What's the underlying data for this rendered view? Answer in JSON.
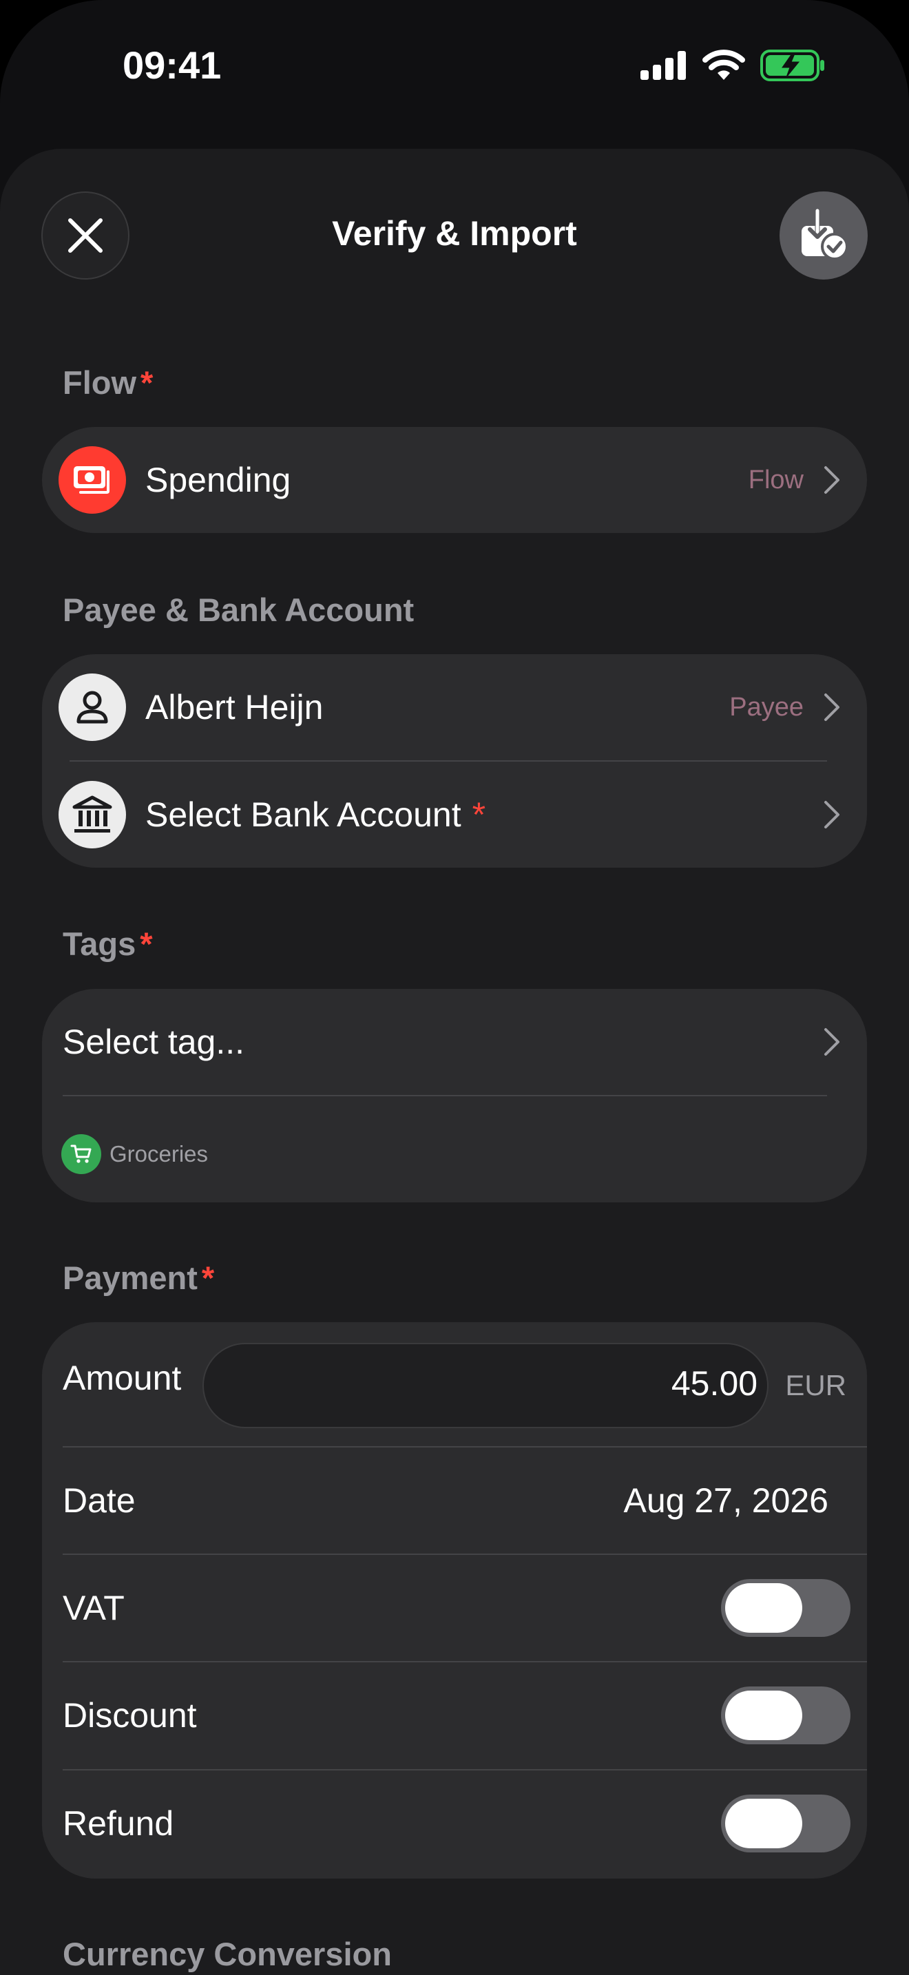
{
  "status_bar": {
    "time": "09:41"
  },
  "sheet": {
    "title": "Verify & Import",
    "close_icon": "close-icon",
    "import_icon": "import-confirm-icon"
  },
  "flow": {
    "label": "Flow",
    "required_mark": "*",
    "value": "Spending",
    "hint": "Flow",
    "icon": "money-icon",
    "icon_color": "#ff3b30"
  },
  "payee_bank": {
    "label": "Payee & Bank Account",
    "payee_value": "Albert Heijn",
    "payee_hint": "Payee",
    "payee_icon": "person-icon",
    "bank_value": "Select Bank Account",
    "bank_required_mark": "*",
    "bank_icon": "bank-icon"
  },
  "tags": {
    "label": "Tags",
    "required_mark": "*",
    "select_label": "Select tag...",
    "chips": [
      {
        "label": "Groceries",
        "icon": "cart-icon",
        "color": "#34a853"
      }
    ]
  },
  "payment": {
    "label": "Payment",
    "required_mark": "*",
    "amount_label": "Amount",
    "amount_value": "45.00",
    "currency": "EUR",
    "date_label": "Date",
    "date_value": "Aug 27, 2026",
    "vat_label": "VAT",
    "vat_on": false,
    "discount_label": "Discount",
    "discount_on": false,
    "refund_label": "Refund",
    "refund_on": false
  },
  "currency_conversion": {
    "label": "Currency Conversion"
  },
  "colors": {
    "accent_red": "#ff453a",
    "hint_color": "#9c6f80",
    "battery_green": "#34c759"
  }
}
